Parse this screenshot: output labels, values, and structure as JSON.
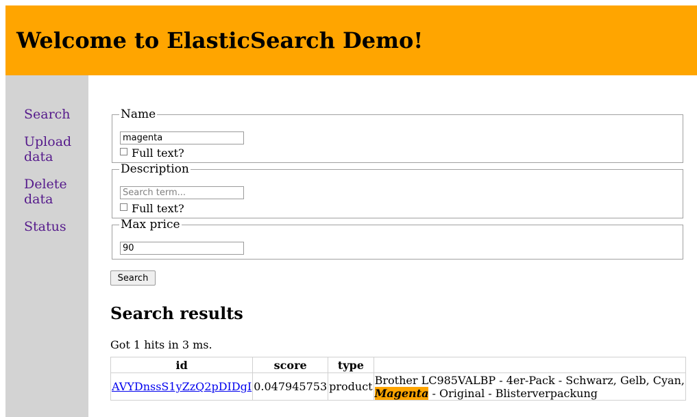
{
  "header": {
    "title": "Welcome to ElasticSearch Demo!"
  },
  "nav": {
    "items": [
      {
        "label": "Search"
      },
      {
        "label": "Upload data"
      },
      {
        "label": "Delete data"
      },
      {
        "label": "Status"
      }
    ]
  },
  "form": {
    "name": {
      "legend": "Name",
      "value": "magenta",
      "fulltext_label": "Full text?"
    },
    "description": {
      "legend": "Description",
      "placeholder": "Search term...",
      "fulltext_label": "Full text?"
    },
    "max_price": {
      "legend": "Max price",
      "value": "90"
    },
    "search_button": "Search"
  },
  "results": {
    "heading": "Search results",
    "hits_text": "Got 1 hits in 3 ms.",
    "columns": [
      "id",
      "score",
      "type",
      ""
    ],
    "rows": [
      {
        "id": "AVYDnssS1yZzQ2pDIDgI",
        "score": "0.047945753",
        "type": "product",
        "desc_before": "Brother LC985VALBP - 4er-Pack - Schwarz, Gelb, Cyan, ",
        "desc_highlight": "Magenta",
        "desc_after": " - Original - Blisterverpackung"
      }
    ]
  },
  "colors": {
    "header_bg": "#ffa500",
    "sidebar_bg": "#d3d3d3",
    "link": "#551a8b",
    "highlight": "#ffa500"
  }
}
